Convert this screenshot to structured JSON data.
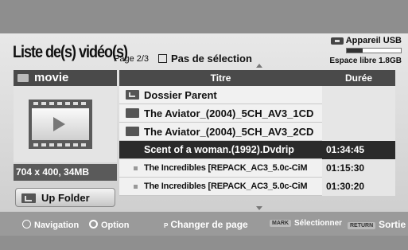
{
  "header": {
    "title": "Liste de(s) vidéo(s)",
    "page": "Page 2/3",
    "selection": "Pas de sélection",
    "usb_device": "Appareil USB",
    "usb_free": "Espace libre 1.8GB",
    "usb_usage": 0.3
  },
  "left_panel": {
    "folder_name": "movie",
    "resolution": "704 x 400, 34MB",
    "up_folder": "Up Folder"
  },
  "table": {
    "col_title": "Titre",
    "col_duration": "Durée",
    "rows": [
      {
        "name": "Dossier Parent",
        "duration": ""
      },
      {
        "name": "The Aviator_(2004)_5CH_AV3_1CD",
        "duration": ""
      },
      {
        "name": "The Aviator_(2004)_5CH_AV3_2CD",
        "duration": ""
      },
      {
        "name": "Scent of a woman.(1992).Dvdrip",
        "duration": "01:34:45"
      },
      {
        "name": "The Incredibles [REPACK_AC3_5.0c-CiM",
        "duration": "01:15:30"
      },
      {
        "name": "The Incredibles [REPACK_AC3_5.0c-CiM",
        "duration": "01:30:20"
      }
    ]
  },
  "footer": {
    "navigation": "Navigation",
    "option": "Option",
    "page_key": "P",
    "change_page": "Changer de page",
    "mark_key": "MARK",
    "select": "Sélectionner",
    "return_key": "RETURN",
    "exit": "Sortie"
  }
}
